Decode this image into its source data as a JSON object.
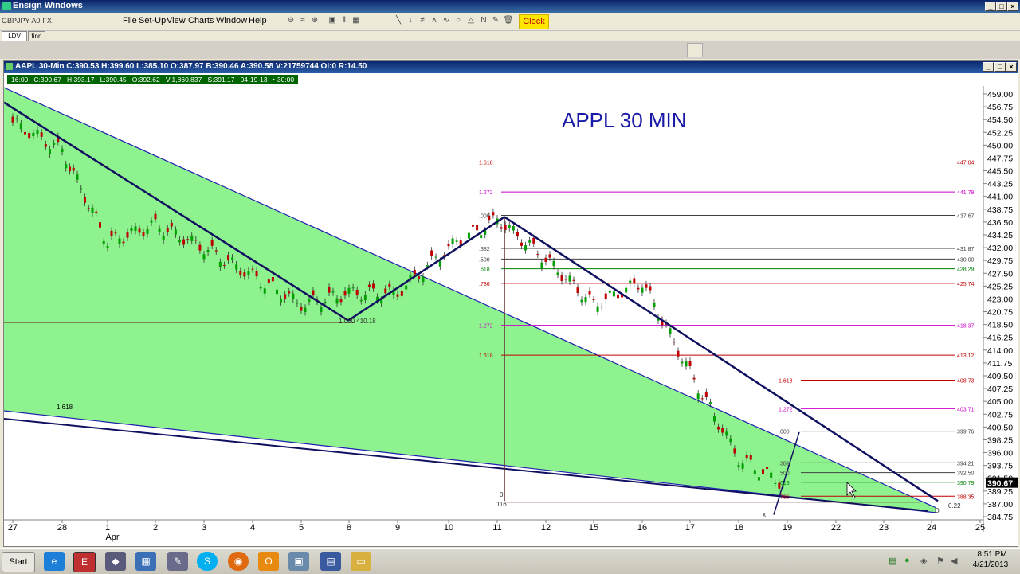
{
  "app": {
    "title": "Ensign Windows",
    "symbol_field": "GBPJPY A0-FX"
  },
  "menu": [
    "File",
    "Set-Up",
    "View",
    "Charts",
    "Window",
    "Help"
  ],
  "toolbar": {
    "clock_label": "Clock",
    "tab1": "LDV",
    "tab2": "finn"
  },
  "chart_window": {
    "title": "AAPL 30-Min C:390.53 H:399.60 L:385.10 O:387.97 B:390.46 A:390.58 V:21759744 OI:0 R:14.50",
    "info": [
      "16:00",
      "C:390.67",
      "H:393.17",
      "L:390.45",
      "O:392.62",
      "V:1,860,837",
      "S:391.17",
      "04-19-13",
      "30:00"
    ]
  },
  "chart_data": {
    "type": "line",
    "title": "APPL   30 MIN",
    "price_axis_labels": [
      "459.00",
      "456.75",
      "454.50",
      "452.25",
      "450.00",
      "447.75",
      "445.50",
      "443.25",
      "441.00",
      "438.75",
      "436.50",
      "434.25",
      "432.00",
      "429.75",
      "427.50",
      "425.25",
      "423.00",
      "420.75",
      "418.50",
      "416.25",
      "414.00",
      "411.75",
      "409.50",
      "407.25",
      "405.00",
      "402.75",
      "400.50",
      "398.25",
      "396.00",
      "393.75",
      "391.50",
      "389.25",
      "387.00",
      "384.75"
    ],
    "current_price": "390.67",
    "x_labels": [
      "27",
      "28",
      "1",
      "2",
      "3",
      "4",
      "5",
      "8",
      "9",
      "10",
      "11",
      "12",
      "15",
      "16",
      "17",
      "18",
      "19",
      "22",
      "23",
      "24",
      "25"
    ],
    "month_label": "Apr",
    "fib_levels": [
      {
        "ratio": "1.618",
        "price": "447.04",
        "color": "#c00000"
      },
      {
        "ratio": "1.272",
        "price": "441.79",
        "color": "#cc00cc"
      },
      {
        "ratio": ".000",
        "price": "437.67",
        "color": "#404040"
      },
      {
        "ratio": ".382",
        "price": "431.87",
        "color": "#404040"
      },
      {
        "ratio": ".500",
        "price": "430.00",
        "color": "#404040"
      },
      {
        "ratio": ".618",
        "price": "428.29",
        "color": "#008000"
      },
      {
        "ratio": ".786",
        "price": "425.74",
        "color": "#c00000"
      },
      {
        "ratio": "1.272",
        "price": "418.37",
        "color": "#cc00cc"
      },
      {
        "ratio": "1.618",
        "price": "413.12",
        "color": "#c00000"
      },
      {
        "ratio": "1.618",
        "price": "408.73",
        "color": "#c00000"
      },
      {
        "ratio": "1.272",
        "price": "403.71",
        "color": "#cc00cc"
      },
      {
        "ratio": ".000",
        "price": "399.76",
        "color": "#404040"
      },
      {
        "ratio": ".382",
        "price": "394.21",
        "color": "#404040"
      },
      {
        "ratio": ".500",
        "price": "392.50",
        "color": "#404040"
      },
      {
        "ratio": ".618",
        "price": "390.79",
        "color": "#008000"
      },
      {
        "ratio": ".786",
        "price": "388.35",
        "color": "#c00000"
      }
    ],
    "annotations": [
      "1.618",
      "1.000 410.18",
      "0.22",
      "116",
      "0",
      "x",
      "D"
    ],
    "series": [
      {
        "x": [
          "03-27",
          "03-28",
          "04-01",
          "04-02",
          "04-03",
          "04-04",
          "04-05",
          "04-08",
          "04-09",
          "04-10",
          "04-11",
          "04-12",
          "04-15",
          "04-16",
          "04-17",
          "04-18",
          "04-19"
        ],
        "values": [
          454,
          449,
          433,
          436,
          432,
          427,
          422,
          424,
          424,
          432,
          437,
          430,
          422,
          426,
          410,
          395,
          390
        ]
      }
    ]
  },
  "taskbar": {
    "start_label": "Start",
    "time": "8:51 PM",
    "date": "4/21/2013"
  }
}
